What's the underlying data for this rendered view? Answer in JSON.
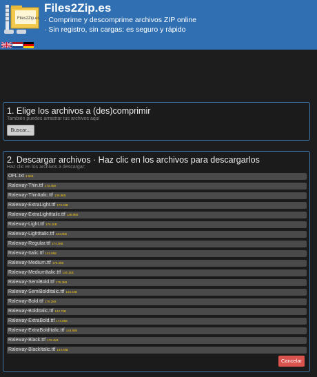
{
  "header": {
    "logo_label": "Files2Zip.es",
    "title": "Files2Zip.es",
    "tagline_1": "· Comprime y descomprime archivos ZIP online",
    "tagline_2": "· Sin registro, sin cargas: es seguro y rápido",
    "flags": [
      "en-flag",
      "nl-flag",
      "de-flag"
    ]
  },
  "step1": {
    "title": "1. Elige los archivos a (des)comprimir",
    "hint": "También puedes arrastrar tus archivos aquí",
    "browse_label": "Buscar..."
  },
  "step2": {
    "title": "2. Descargar archivos · Haz clic en los archivos para descargarlos",
    "hint": "Haz clic en los archivos a descargar:",
    "files": [
      {
        "name": "OFL.txt",
        "size": "4.5kB"
      },
      {
        "name": "Raleway-Thin.ttf",
        "size": "173.4kB"
      },
      {
        "name": "Raleway-ThinItalic.ttf",
        "size": "136.8kB"
      },
      {
        "name": "Raleway-ExtraLight.ttf",
        "size": "172.2kB"
      },
      {
        "name": "Raleway-ExtraLightItalic.ttf",
        "size": "138.8kB"
      },
      {
        "name": "Raleway-Light.ttf",
        "size": "176.1kB"
      },
      {
        "name": "Raleway-LightItalic.ttf",
        "size": "144.6kB"
      },
      {
        "name": "Raleway-Regular.ttf",
        "size": "174.3kB"
      },
      {
        "name": "Raleway-Italic.ttf",
        "size": "142.5kB"
      },
      {
        "name": "Raleway-Medium.ttf",
        "size": "175.2kB"
      },
      {
        "name": "Raleway-MediumItalic.ttf",
        "size": "144.1kB"
      },
      {
        "name": "Raleway-SemiBold.ttf",
        "size": "175.3kB"
      },
      {
        "name": "Raleway-SemiBoldItalic.ttf",
        "size": "143.1kB"
      },
      {
        "name": "Raleway-Bold.ttf",
        "size": "175.2kB"
      },
      {
        "name": "Raleway-BoldItalic.ttf",
        "size": "144.7kB"
      },
      {
        "name": "Raleway-ExtraBold.ttf",
        "size": "174.0kB"
      },
      {
        "name": "Raleway-ExtraBoldItalic.ttf",
        "size": "144.8kB"
      },
      {
        "name": "Raleway-Black.ttf",
        "size": "176.4kB"
      },
      {
        "name": "Raleway-BlackItalic.ttf",
        "size": "144.8kB"
      }
    ],
    "cancel_label": "Cancelar"
  },
  "colors": {
    "header_bg": "#2f6fb2",
    "panel_border": "#3e78ad",
    "file_size": "#f0c419",
    "cancel_bg": "#d9534f"
  }
}
